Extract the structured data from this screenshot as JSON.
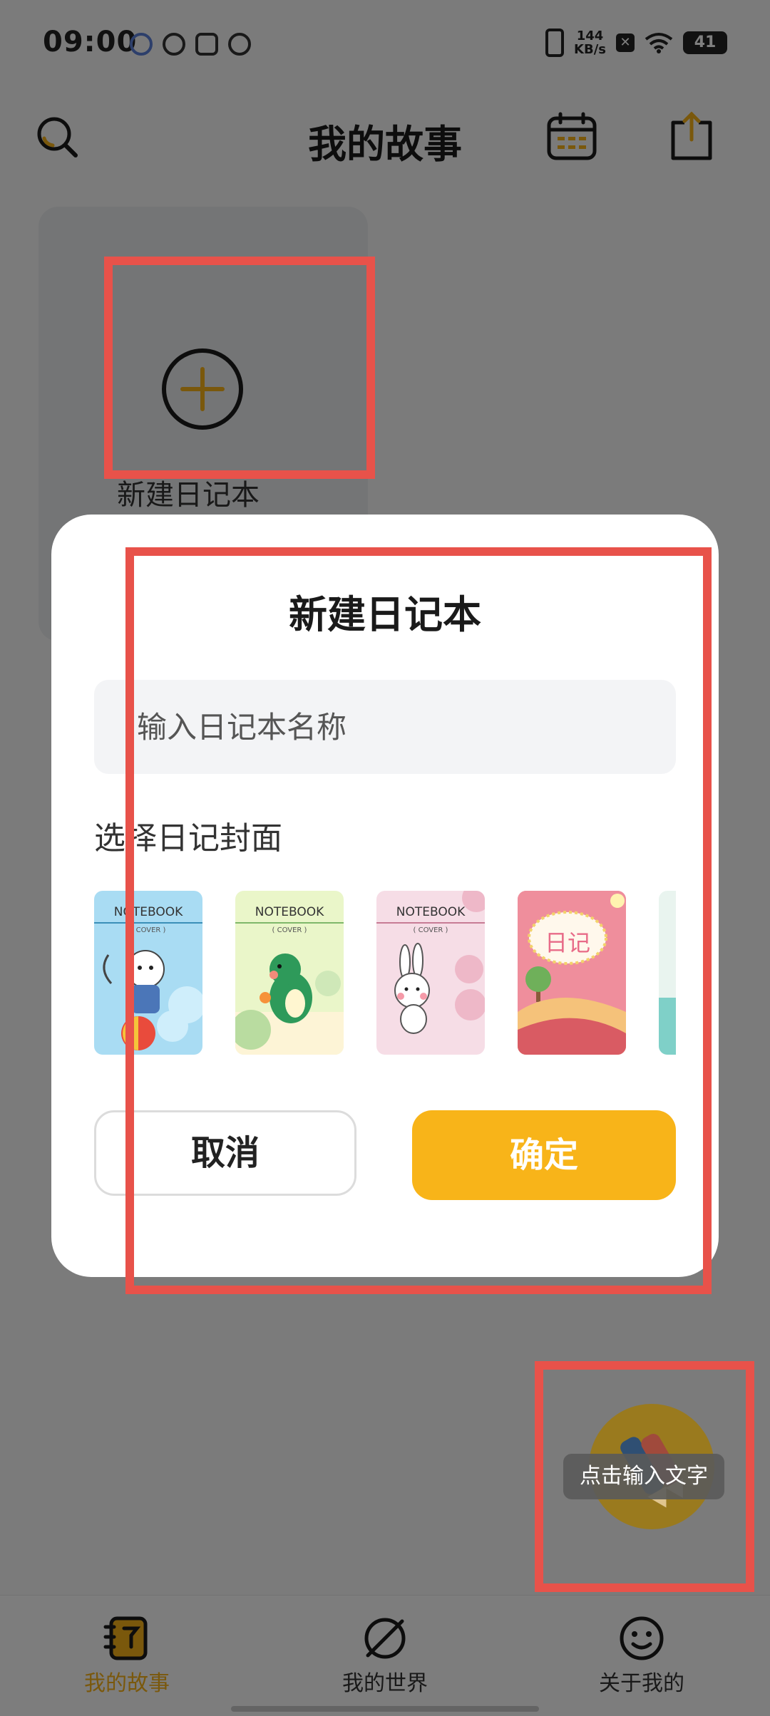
{
  "status_bar": {
    "time": "09:00",
    "network_speed_value": "144",
    "network_speed_unit": "KB/s",
    "battery": "41"
  },
  "header": {
    "title": "我的故事"
  },
  "notebook_card": {
    "label": "新建日记本"
  },
  "dialog": {
    "title": "新建日记本",
    "name_placeholder": "输入日记本名称",
    "name_value": "",
    "cover_label": "选择日记封面",
    "covers": [
      {
        "title": "NOTEBOOK",
        "subtitle": "( COVER )",
        "theme": "cat-blue",
        "bg": "#a9dcf3"
      },
      {
        "title": "NOTEBOOK",
        "subtitle": "( COVER )",
        "theme": "dino-green",
        "bg": "#eaf6c9"
      },
      {
        "title": "NOTEBOOK",
        "subtitle": "( COVER )",
        "theme": "rabbit-pink",
        "bg": "#f6dde6"
      },
      {
        "title": "日记",
        "subtitle": "",
        "theme": "landscape-pink",
        "bg": "#e87f8f"
      }
    ],
    "cancel_label": "取消",
    "confirm_label": "确定"
  },
  "fab": {
    "tooltip": "点击输入文字"
  },
  "bottom_nav": {
    "items": [
      {
        "label": "我的故事",
        "icon": "notebook-icon",
        "active": true
      },
      {
        "label": "我的世界",
        "icon": "planet-icon",
        "active": false
      },
      {
        "label": "关于我的",
        "icon": "smile-icon",
        "active": false
      }
    ]
  },
  "colors": {
    "accent": "#f8b419",
    "annotation": "#e8524a"
  }
}
